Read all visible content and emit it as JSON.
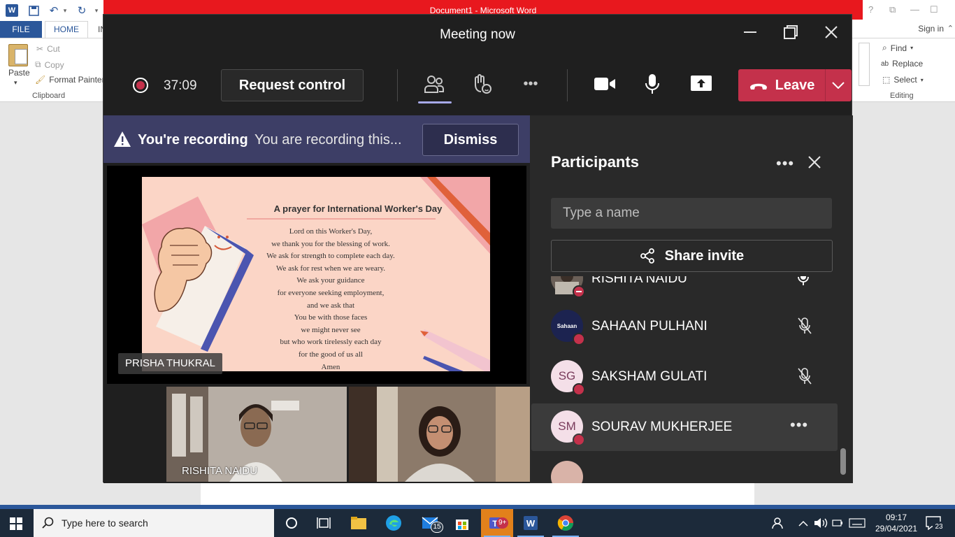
{
  "word": {
    "title": "Document1 -  Microsoft Word",
    "tabs": {
      "file": "FILE",
      "home": "HOME",
      "insert": "IN"
    },
    "sign_in": "Sign in",
    "clipboard": {
      "paste": "Paste",
      "cut": "Cut",
      "copy": "Copy",
      "format_painter": "Format Painter",
      "group_label": "Clipboard"
    },
    "editing": {
      "find": "Find",
      "replace": "Replace",
      "select": "Select",
      "group_label": "Editing"
    }
  },
  "teams": {
    "window_title": "Meeting now",
    "toolbar": {
      "timer": "37:09",
      "request_control": "Request control",
      "more": "•••",
      "leave": "Leave"
    },
    "banner": {
      "title": "You're recording",
      "message": "You are recording this...",
      "dismiss": "Dismiss"
    },
    "stage": {
      "presenter_name": "PRISHA THUKRAL",
      "slide": {
        "title": "A prayer for International Worker's Day",
        "lines": [
          "Lord on this Worker's Day,",
          "we thank you for the blessing of work.",
          "We ask for strength to complete each day.",
          "We ask for rest when we are weary.",
          "We ask your guidance",
          "for everyone seeking employment,",
          "and we ask that",
          "You be with those faces",
          "we might never see",
          "but who work tirelessly each day",
          "for the good of us all",
          "Amen"
        ]
      },
      "video_tiles": [
        {
          "name": "RISHITA NAIDU"
        },
        {
          "name": ""
        }
      ]
    },
    "participants": {
      "title": "Participants",
      "more": "•••",
      "search_placeholder": "Type a name",
      "share_invite": "Share invite",
      "list": [
        {
          "name": "RISHITA NAIDU",
          "initials": "",
          "mic": "on"
        },
        {
          "name": "SAHAAN PULHANI",
          "initials": "",
          "avatar_text": "Sahaan",
          "mic": "muted"
        },
        {
          "name": "SAKSHAM GULATI",
          "initials": "SG",
          "mic": "muted"
        },
        {
          "name": "SOURAV MUKHERJEE",
          "initials": "SM",
          "mic": "more",
          "more": "•••"
        }
      ]
    }
  },
  "taskbar": {
    "search_placeholder": "Type here to search",
    "mail_badge": "15",
    "teams_badge": "9+",
    "time": "09:17",
    "date": "29/04/2021",
    "notifications": "23"
  },
  "colors": {
    "teams_bg": "#292929",
    "teams_dark": "#1f1f1f",
    "leave_red": "#c4314b",
    "banner": "#3d3e66",
    "word_blue": "#2b579a",
    "word_red_title": "#e8181e"
  }
}
